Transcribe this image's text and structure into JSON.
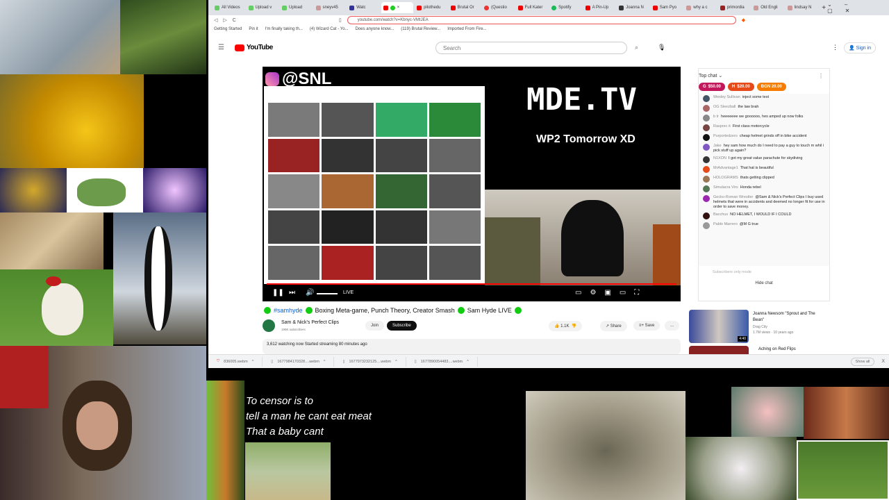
{
  "browser": {
    "tabs": [
      "All Videos",
      "Upload v",
      "Upload",
      "sneyv45",
      "Watc",
      "",
      "pilothedu",
      "Brutal Or",
      "(Questio",
      "Full Kater",
      "Spotify",
      "A Pin-Up",
      "Joanna N",
      "Sam Pyo",
      "why a c",
      "primordia",
      "Old Engli",
      "lindsay N"
    ],
    "url": "youtube.com/watch?v=Kbnyc-VMtJEA",
    "bookmarks": [
      "Getting Started",
      "Pin it",
      "I'm finally taking th...",
      "(4) Wizard Cat - Yo...",
      "Does anyone know...",
      "(119) Brutal Review...",
      "Imported From Fire..."
    ]
  },
  "youtube": {
    "logo": "YouTube",
    "search_placeholder": "Search",
    "sign_in": "Sign in",
    "video": {
      "overlay_handle": "@SNL",
      "overlay_title": "MDE.TV",
      "overlay_sub": "WP2 Tomorrow XD",
      "live": "LIVE"
    },
    "title_hashtag": "#samhyde",
    "title": "Boxing Meta-game, Punch Theory, Creator Smash",
    "title_end": "Sam Hyde LIVE",
    "channel": "Sam & Nick's Perfect Clips",
    "subscribers": "199K subscribers",
    "join": "Join",
    "subscribe": "Subscribe",
    "likes": "1.1K",
    "share": "Share",
    "save": "Save",
    "more": "...",
    "description": "3,612 watching now  Started streaming 80 minutes ago",
    "chat": {
      "header": "Top chat",
      "donations": [
        {
          "init": "G",
          "amount": "$50.00",
          "color": "#c2185b"
        },
        {
          "init": "H",
          "amount": "$20.00",
          "color": "#e64a19"
        },
        {
          "init": "",
          "amount": "BGN 20.00",
          "color": "#f57c00"
        }
      ],
      "messages": [
        {
          "user": "Wesley Sullivan",
          "text": "inject some test",
          "color": "#456"
        },
        {
          "user": "OG Sleezball",
          "text": "the law brah",
          "color": "#a66"
        },
        {
          "user": "b tr",
          "text": "heeeeeee we goooooo, hes amped up now folks",
          "color": "#888"
        },
        {
          "user": "Rasprec it",
          "text": "First class motorcycle",
          "color": "#744"
        },
        {
          "user": "Purportedzero",
          "text": "cheap helmet grinds off in bike accident",
          "color": "#111"
        },
        {
          "user": "Jake",
          "text": "hey sam how much do I need to pay a guy to touch m whil i pick stuff up again?",
          "color": "#7e57c2"
        },
        {
          "user": "N1XON",
          "text": "I got my great value parachute for skydiving",
          "color": "#333"
        },
        {
          "user": "MrAdvantage1",
          "text": "That hat is beautiful",
          "color": "#e64a19"
        },
        {
          "user": "HOLOGRAMS",
          "text": "thats getting clipped",
          "color": "#975"
        },
        {
          "user": "Simulacra Viro",
          "text": "Honda rebel",
          "color": "#575"
        },
        {
          "user": "Gecko-Roman Wrestler",
          "text": "@Sam & Nick's Perfect Clips I buy used helmets that were in accidents and deemed no longer fit for use in order to save money.",
          "color": "#9c27b0"
        },
        {
          "user": "Bacchus",
          "text": "NO HELMET, I WOULD IF I COULD",
          "color": "#311"
        },
        {
          "user": "Pablo Marrero",
          "text": "@M G true",
          "color": "#999"
        }
      ],
      "subscribers_only": "Subscribers only mode",
      "hide_chat": "Hide chat"
    },
    "recommended": [
      {
        "title": "Joanna Newsom \"Sprout and The Bean\"",
        "channel": "Drag City",
        "meta": "1.7M views · 10 years ago",
        "duration": "4:40"
      },
      {
        "title": "Aching on Red Flips",
        "channel": "",
        "meta": "",
        "duration": ""
      }
    ]
  },
  "downloads": {
    "items": [
      "836005.webm",
      "1677984170328....webm",
      "1677973232125....webm",
      "1677890054483....webm"
    ],
    "show_all": "Show all",
    "close": "X"
  },
  "overlay_text": {
    "line1": "To censor is to",
    "line2": "tell a man he cant eat meat",
    "line3": "That a baby cant"
  }
}
